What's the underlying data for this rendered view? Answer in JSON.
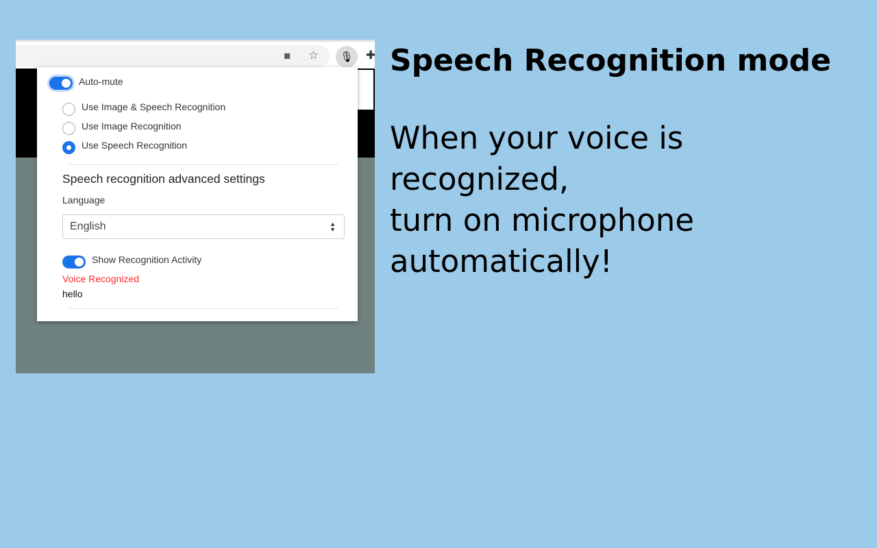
{
  "popup": {
    "auto_mute_label": "Auto-mute",
    "auto_mute_on": true,
    "modes": [
      {
        "label": "Use Image & Speech Recognition",
        "selected": false
      },
      {
        "label": "Use Image Recognition",
        "selected": false
      },
      {
        "label": "Use Speech Recognition",
        "selected": true
      }
    ],
    "advanced_title": "Speech recognition advanced settings",
    "language_label": "Language",
    "language_value": "English",
    "show_activity_label": "Show Recognition Activity",
    "show_activity_on": true,
    "status_text": "Voice Recognized",
    "status_color": "#ff2a2a",
    "recognized_text": "hello"
  },
  "toolbar": {
    "icons": [
      "video-camera-icon",
      "star-icon",
      "microphone-extension-icon",
      "puzzle-extensions-icon"
    ]
  },
  "side": {
    "title": "Speech Recognition mode",
    "body": "When your voice is\nrecognized,\nturn on microphone\nautomatically!"
  },
  "colors": {
    "background": "#9ccae9",
    "accent": "#1a73e8"
  }
}
